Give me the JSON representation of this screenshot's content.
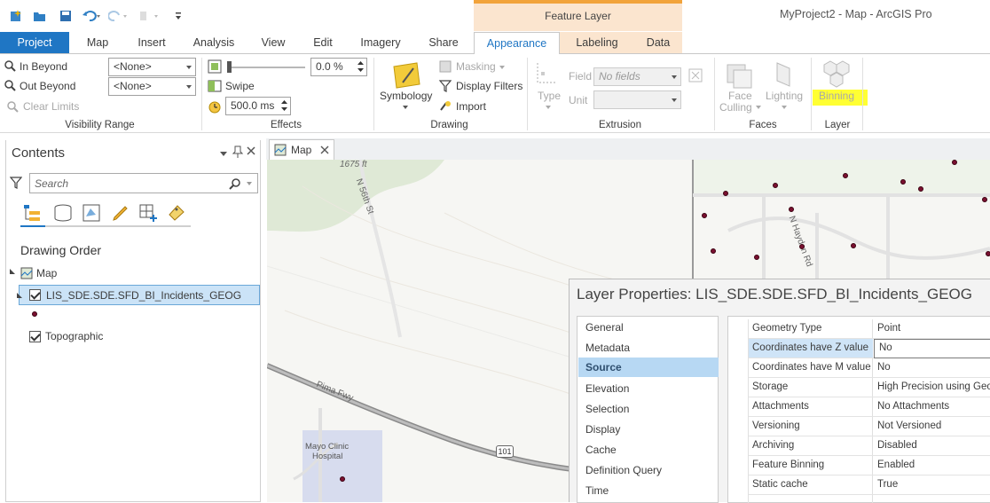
{
  "window": {
    "title": "MyProject2 - Map - ArcGIS Pro",
    "contextual_group": "Feature Layer"
  },
  "tabs": [
    "Project",
    "Map",
    "Insert",
    "Analysis",
    "View",
    "Edit",
    "Imagery",
    "Share",
    "Appearance",
    "Labeling",
    "Data"
  ],
  "active_tab": "Appearance",
  "ribbon": {
    "visibility_range": {
      "in_beyond_label": "In Beyond",
      "in_beyond_value": "<None>",
      "out_beyond_label": "Out Beyond",
      "out_beyond_value": "<None>",
      "clear_limits": "Clear Limits",
      "group_label": "Visibility Range"
    },
    "effects": {
      "transparency_value": "0.0 %",
      "swipe": "Swipe",
      "flicker_value": "500.0 ms",
      "group_label": "Effects"
    },
    "drawing": {
      "symbology": "Symbology",
      "masking": "Masking",
      "display_filters": "Display Filters",
      "import": "Import",
      "group_label": "Drawing"
    },
    "extrusion": {
      "type": "Type",
      "field_label": "Field",
      "field_value": "No fields",
      "unit_label": "Unit",
      "group_label": "Extrusion"
    },
    "faces": {
      "face_culling_1": "Face",
      "face_culling_2": "Culling",
      "lighting": "Lighting",
      "group_label": "Faces"
    },
    "layer": {
      "binning": "Binning",
      "group_label": "Layer"
    }
  },
  "contents": {
    "title": "Contents",
    "search_placeholder": "Search",
    "drawing_order": "Drawing Order",
    "map_item": "Map",
    "layer_item": "LIS_SDE.SDE.SFD_BI_Incidents_GEOG",
    "basemap_item": "Topographic"
  },
  "map_tab": {
    "label": "Map"
  },
  "map_labels": {
    "contour": "1675 ft",
    "street_56": "N 56th St",
    "hayden": "N Hayden Rd",
    "pima": "Pima Fwy",
    "shield": "101",
    "mayo_1": "Mayo Clinic",
    "mayo_2": "Hospital"
  },
  "dialog": {
    "title": "Layer Properties: LIS_SDE.SDE.SFD_BI_Incidents_GEOG",
    "nav": [
      "General",
      "Metadata",
      "Source",
      "Elevation",
      "Selection",
      "Display",
      "Cache",
      "Definition Query",
      "Time"
    ],
    "selected_nav": "Source",
    "properties": [
      {
        "key": "Geometry Type",
        "value": "Point"
      },
      {
        "key": "Coordinates have Z value",
        "value": "No"
      },
      {
        "key": "Coordinates have M value",
        "value": "No"
      },
      {
        "key": "Storage",
        "value": "High Precision using Geo"
      },
      {
        "key": "Attachments",
        "value": "No Attachments"
      },
      {
        "key": "Versioning",
        "value": "Not Versioned"
      },
      {
        "key": "Archiving",
        "value": "Disabled"
      },
      {
        "key": "Feature Binning",
        "value": "Enabled"
      },
      {
        "key": "Static cache",
        "value": "True"
      }
    ]
  },
  "colors": {
    "accent": "#1f76c4",
    "contextual": "#fbe5cf",
    "highlight": "#ffff00",
    "selection": "#b7d8f3",
    "point": "#7a1030"
  }
}
